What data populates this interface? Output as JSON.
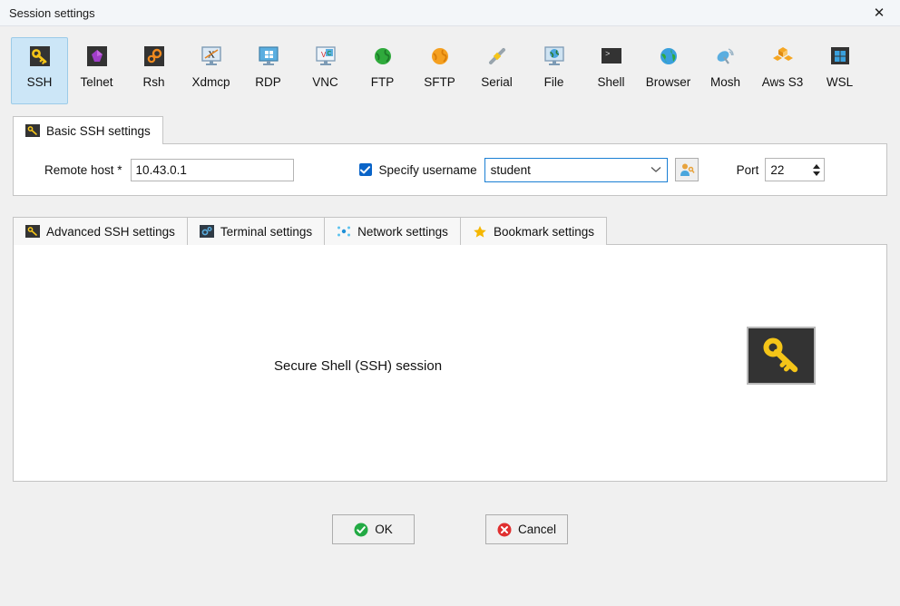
{
  "titlebar": {
    "title": "Session settings",
    "close_icon": "close-icon"
  },
  "session_types": [
    {
      "label": "SSH",
      "icon": "ssh-key-icon",
      "selected": true
    },
    {
      "label": "Telnet",
      "icon": "telnet-gem-icon",
      "selected": false
    },
    {
      "label": "Rsh",
      "icon": "rsh-gears-icon",
      "selected": false
    },
    {
      "label": "Xdmcp",
      "icon": "xdmcp-monitor-icon",
      "selected": false
    },
    {
      "label": "RDP",
      "icon": "rdp-monitor-icon",
      "selected": false
    },
    {
      "label": "VNC",
      "icon": "vnc-monitor-icon",
      "selected": false
    },
    {
      "label": "FTP",
      "icon": "ftp-globe-icon",
      "selected": false
    },
    {
      "label": "SFTP",
      "icon": "sftp-globe-icon",
      "selected": false
    },
    {
      "label": "Serial",
      "icon": "serial-plug-icon",
      "selected": false
    },
    {
      "label": "File",
      "icon": "file-monitor-icon",
      "selected": false
    },
    {
      "label": "Shell",
      "icon": "shell-terminal-icon",
      "selected": false
    },
    {
      "label": "Browser",
      "icon": "browser-globe-icon",
      "selected": false
    },
    {
      "label": "Mosh",
      "icon": "mosh-dish-icon",
      "selected": false
    },
    {
      "label": "Aws S3",
      "icon": "aws-s3-cubes-icon",
      "selected": false
    },
    {
      "label": "WSL",
      "icon": "wsl-windows-icon",
      "selected": false
    }
  ],
  "basic_tab": {
    "label": "Basic SSH settings",
    "icon": "ssh-key-icon"
  },
  "basic_settings": {
    "remote_host_label": "Remote host *",
    "remote_host_value": "10.43.0.1",
    "specify_username_label": "Specify username",
    "specify_username_checked": true,
    "username_value": "student",
    "user_button_icon": "user-key-icon",
    "port_label": "Port",
    "port_value": "22"
  },
  "settings_tabs": [
    {
      "label": "Advanced SSH settings",
      "icon": "ssh-key-icon",
      "active": false
    },
    {
      "label": "Terminal settings",
      "icon": "terminal-icon",
      "active": false
    },
    {
      "label": "Network settings",
      "icon": "network-dots-icon",
      "active": false
    },
    {
      "label": "Bookmark settings",
      "icon": "star-icon",
      "active": false
    }
  ],
  "content": {
    "session_description": "Secure Shell (SSH) session",
    "illustration_icon": "ssh-key-large-icon"
  },
  "footer": {
    "ok_label": "OK",
    "ok_icon": "check-circle-icon",
    "cancel_label": "Cancel",
    "cancel_icon": "x-circle-icon"
  },
  "colors": {
    "selected_tile": "#cce6f7",
    "accent_blue": "#0a64c8",
    "key_yellow": "#f5c518",
    "ok_green": "#22aa44",
    "cancel_red": "#e03030"
  }
}
